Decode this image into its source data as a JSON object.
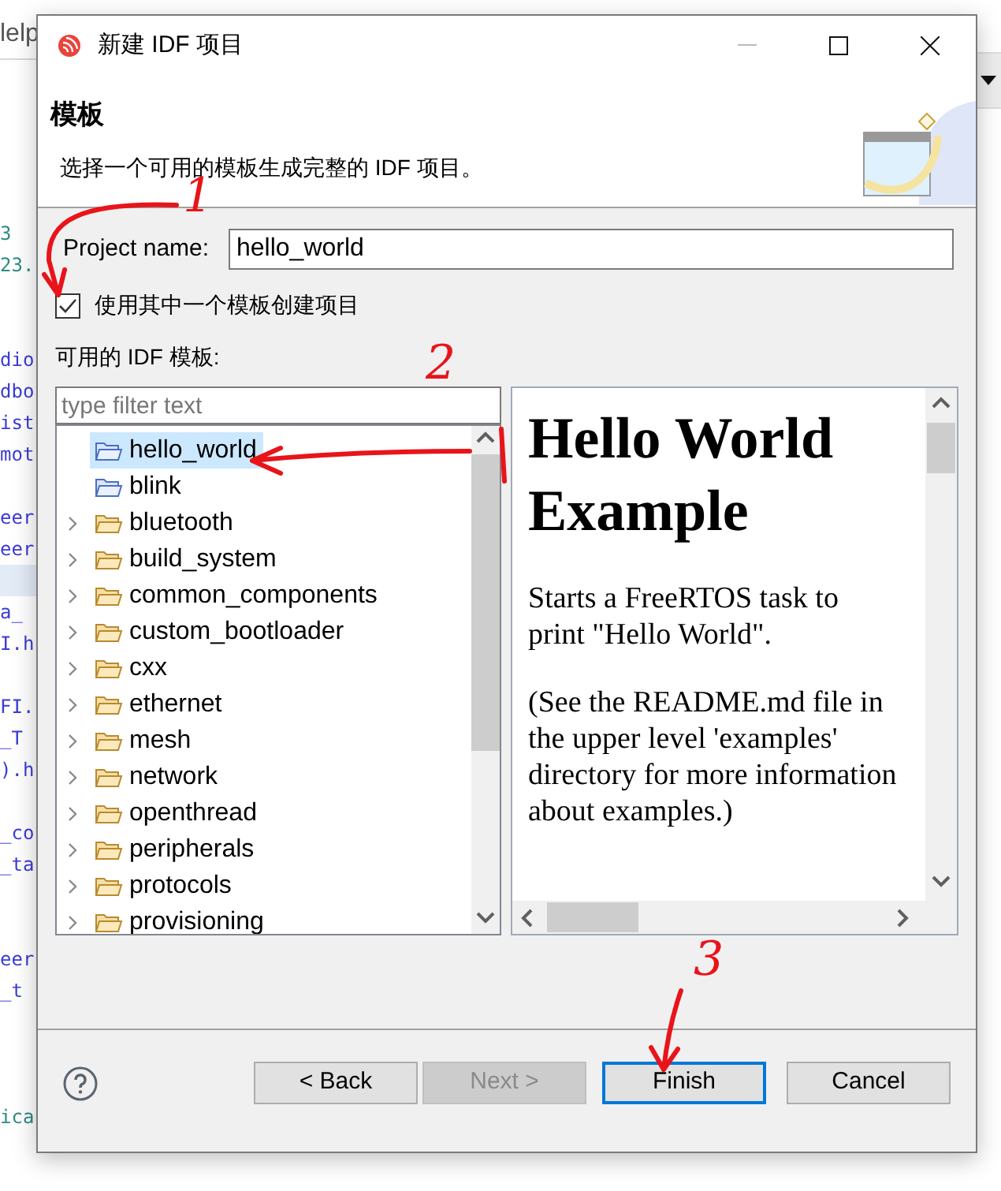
{
  "background": {
    "menu_fragment": "lelp",
    "code_lines": [
      {
        "kind": "code",
        "text": "3",
        "color": "#2e8b82"
      },
      {
        "kind": "code",
        "text": "23.",
        "color": "#2e8b82"
      },
      {
        "kind": "blank"
      },
      {
        "kind": "blank"
      },
      {
        "kind": "code",
        "text": "dio",
        "color": "#3b3bd6"
      },
      {
        "kind": "code",
        "text": "dbo",
        "color": "#3b3bd6"
      },
      {
        "kind": "code",
        "text": "ist",
        "color": "#3b3bd6"
      },
      {
        "kind": "code",
        "text": "mot",
        "color": "#3b3bd6"
      },
      {
        "kind": "blank"
      },
      {
        "kind": "code",
        "text": "eer",
        "color": "#3b3bd6"
      },
      {
        "kind": "code",
        "text": "eer",
        "color": "#3b3bd6"
      },
      {
        "kind": "current"
      },
      {
        "kind": "code",
        "text": "a_",
        "color": "#3b3bd6"
      },
      {
        "kind": "code",
        "text": "I.h",
        "color": "#3b3bd6"
      },
      {
        "kind": "blank"
      },
      {
        "kind": "code",
        "text": "FI.",
        "color": "#3b3bd6"
      },
      {
        "kind": "code",
        "text": "_T",
        "color": "#3b3bd6"
      },
      {
        "kind": "code",
        "text": ").h",
        "color": "#3b3bd6"
      },
      {
        "kind": "blank"
      },
      {
        "kind": "code",
        "text": "_co",
        "color": "#3b3bd6"
      },
      {
        "kind": "code",
        "text": "_ta",
        "color": "#3b3bd6"
      },
      {
        "kind": "blank"
      },
      {
        "kind": "blank"
      },
      {
        "kind": "code",
        "text": "eer",
        "color": "#3b3bd6"
      },
      {
        "kind": "code",
        "text": "_t",
        "color": "#3b3bd6"
      },
      {
        "kind": "blank"
      },
      {
        "kind": "blank"
      },
      {
        "kind": "blank"
      },
      {
        "kind": "code",
        "text": "ica",
        "color": "#2e8b82"
      }
    ]
  },
  "dialog": {
    "title": "新建 IDF 项目",
    "header": {
      "title": "模板",
      "description": "选择一个可用的模板生成完整的 IDF 项目。"
    },
    "project_name": {
      "label": "Project name:",
      "value": "hello_world"
    },
    "use_template": {
      "label": "使用其中一个模板创建项目",
      "checked": true
    },
    "templates_label": "可用的 IDF 模板:",
    "filter": {
      "placeholder": "type filter text"
    },
    "tree": [
      {
        "kind": "template",
        "label": "hello_world",
        "selected": true
      },
      {
        "kind": "template",
        "label": "blink",
        "selected": false
      },
      {
        "kind": "category",
        "label": "bluetooth",
        "selected": false
      },
      {
        "kind": "category",
        "label": "build_system",
        "selected": false
      },
      {
        "kind": "category",
        "label": "common_components",
        "selected": false
      },
      {
        "kind": "category",
        "label": "custom_bootloader",
        "selected": false
      },
      {
        "kind": "category",
        "label": "cxx",
        "selected": false
      },
      {
        "kind": "category",
        "label": "ethernet",
        "selected": false
      },
      {
        "kind": "category",
        "label": "mesh",
        "selected": false
      },
      {
        "kind": "category",
        "label": "network",
        "selected": false
      },
      {
        "kind": "category",
        "label": "openthread",
        "selected": false
      },
      {
        "kind": "category",
        "label": "peripherals",
        "selected": false
      },
      {
        "kind": "category",
        "label": "protocols",
        "selected": false
      },
      {
        "kind": "category",
        "label": "provisioning",
        "selected": false
      }
    ],
    "preview": {
      "title": "Hello World Example",
      "paragraphs": [
        "Starts a FreeRTOS task to print \"Hello World\".",
        "(See the README.md file in the upper level 'examples' directory for more information about examples.)"
      ]
    },
    "buttons": [
      {
        "label": "< Back",
        "disabled": false,
        "default": false
      },
      {
        "label": "Next >",
        "disabled": true,
        "default": false
      },
      {
        "label": "Finish",
        "disabled": false,
        "default": true
      },
      {
        "label": "Cancel",
        "disabled": false,
        "default": false
      }
    ]
  },
  "annotations": [
    {
      "label": "1"
    },
    {
      "label": "2"
    },
    {
      "label": "3"
    }
  ]
}
